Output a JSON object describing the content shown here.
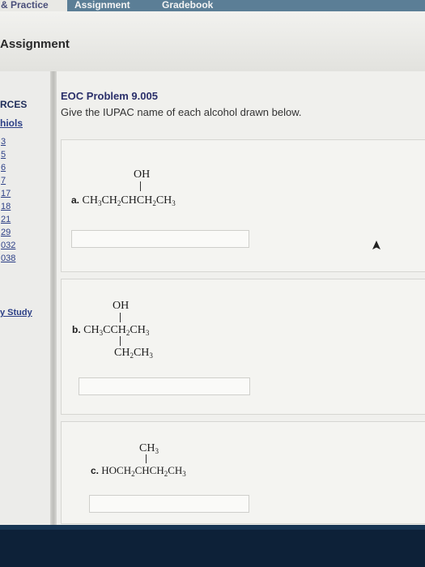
{
  "tabs": {
    "practice": "& Practice",
    "assignment": "Assignment",
    "gradebook": "Gradebook"
  },
  "page_title": "Assignment",
  "sidebar": {
    "heading1": "RCES",
    "heading2": "hiols",
    "links": [
      "3",
      "5",
      "6",
      "7",
      "17",
      "18",
      "21",
      "29",
      "032",
      "038"
    ],
    "study": "y Study"
  },
  "problem": {
    "title": "EOC Problem 9.005",
    "prompt": "Give the IUPAC name of each alcohol drawn below."
  },
  "parts": [
    {
      "label": "a.",
      "substituent": "OH",
      "answer": ""
    },
    {
      "label": "b.",
      "substituent_top": "OH",
      "substituent_bottom": "CH2CH3",
      "answer": ""
    },
    {
      "label": "c.",
      "substituent": "CH3",
      "answer": ""
    }
  ],
  "colors": {
    "topbar": "#5b7e96",
    "link": "#2c3f86",
    "title": "#2a2f6a",
    "taskbar": "#0d2138"
  }
}
